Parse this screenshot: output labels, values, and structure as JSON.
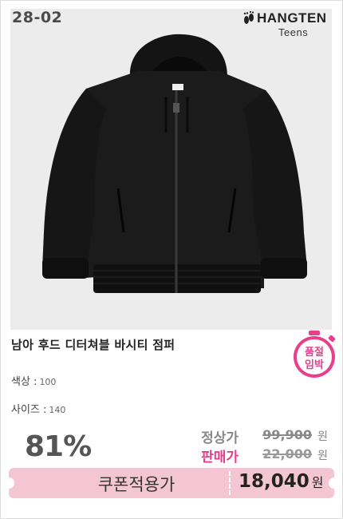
{
  "product": {
    "code": "28-02",
    "brand_line1": "HANGTEN",
    "brand_line2": "Teens",
    "name": "남아 후드 디터쳐블 바시티 점퍼",
    "sticker_line1": "품절",
    "sticker_line2": "임박"
  },
  "options": {
    "color_label": "색상 :",
    "color_value": "100",
    "size_label": "사이즈 :",
    "size_value": "140"
  },
  "pricing": {
    "discount": "81%",
    "regular_label": "정상가",
    "regular_price": "99,900",
    "sale_label": "판매가",
    "sale_price": "22,000",
    "currency": "원"
  },
  "coupon": {
    "label": "쿠폰적용가",
    "final_price": "18,040",
    "currency": "원"
  },
  "colors": {
    "accent_pink": "#e83e8c",
    "coupon_bg": "#f4c6d3",
    "sticker": "#e83e8c"
  },
  "icons": {
    "brand_logo": "footprints-icon",
    "sticker": "stopwatch-icon"
  }
}
